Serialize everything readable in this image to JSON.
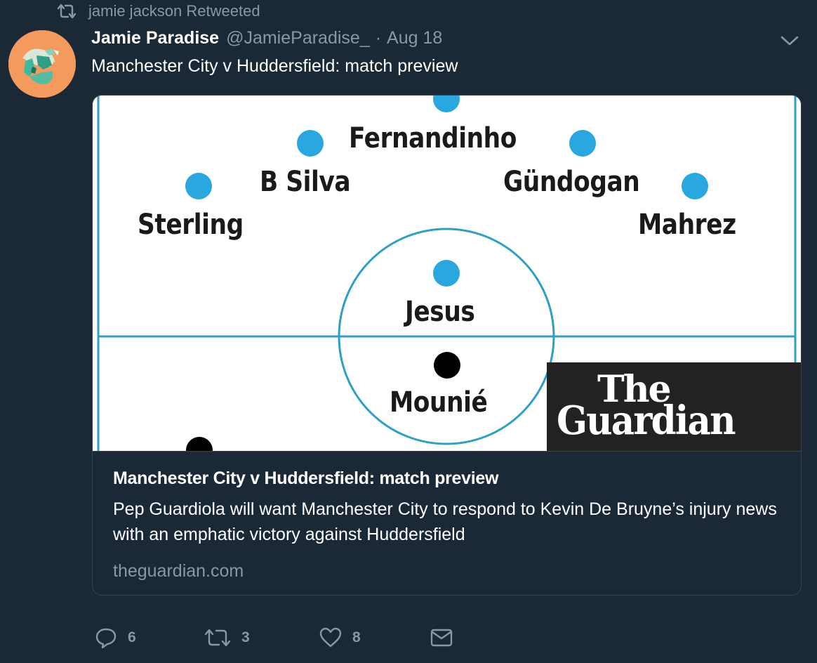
{
  "retweet": {
    "text": "jamie jackson Retweeted",
    "icon": "retweet-icon"
  },
  "author": {
    "display_name": "Jamie Paradise",
    "handle": "@JamieParadise_",
    "separator": "·",
    "date": "Aug 18"
  },
  "tweet": {
    "text": "Manchester City v Huddersfield: match preview"
  },
  "card": {
    "image": {
      "players_city": [
        "Fernandinho",
        "B Silva",
        "Gündogan",
        "Sterling",
        "Mahrez",
        "Jesus"
      ],
      "players_huddersfield": [
        "Mounié"
      ],
      "logo_line1": "The",
      "logo_line2": "Guardian"
    },
    "title": "Manchester City v Huddersfield: match preview",
    "description": "Pep Guardiola will want Manchester City to respond to Kevin De Bruyne’s injury news with an emphatic victory against Huddersfield",
    "domain": "theguardian.com"
  },
  "actions": {
    "reply_count": "6",
    "retweet_count": "3",
    "like_count": "8"
  },
  "colors": {
    "background": "#1b2836",
    "secondary_text": "#8899a6",
    "pitch_line": "#2e9fc5",
    "city_dot": "#29a8e0",
    "opponent_dot": "#000000"
  }
}
